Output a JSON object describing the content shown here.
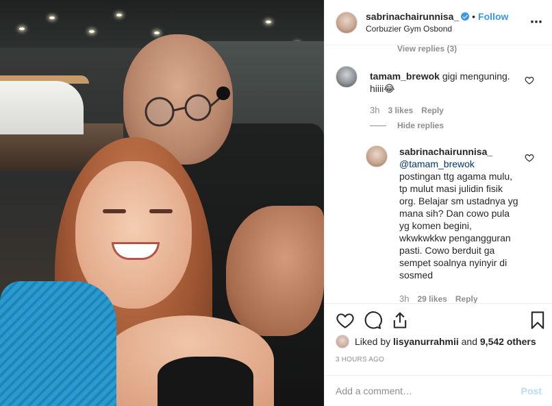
{
  "header": {
    "username": "sabrinachairunnisa_",
    "separator": "•",
    "follow_label": "Follow",
    "location": "Corbuzier Gym Osbond",
    "more_icon": "more-options-icon"
  },
  "comments": {
    "faded_view_replies": "View replies (3)",
    "comment1": {
      "username": "tamam_brewok",
      "text": "gigi menguning. hiiii😂",
      "time": "3h",
      "likes": "3 likes",
      "reply": "Reply"
    },
    "hide_replies": "Hide replies",
    "reply1": {
      "username": "sabrinachairunnisa_",
      "mention": "@tamam_brewok",
      "text": "postingan ttg agama mulu, tp mulut masi julidin fisik org. Belajar sm ustadnya yg mana sih? Dan cowo pula yg komen begini, wkwkwkkw pengangguran pasti. Cowo berduit ga sempet soalnya nyinyir di sosmed",
      "time": "3h",
      "likes": "29 likes",
      "reply": "Reply"
    }
  },
  "likes": {
    "prefix": "Liked by",
    "user": "lisyanurrahmii",
    "and": "and",
    "others": "9,542 others"
  },
  "timestamp": "3 HOURS AGO",
  "add_comment": {
    "placeholder": "Add a comment…",
    "post_label": "Post"
  },
  "colors": {
    "link_blue": "#3897f0",
    "muted": "#8e8e8e",
    "post_disabled": "#b2dffc"
  }
}
